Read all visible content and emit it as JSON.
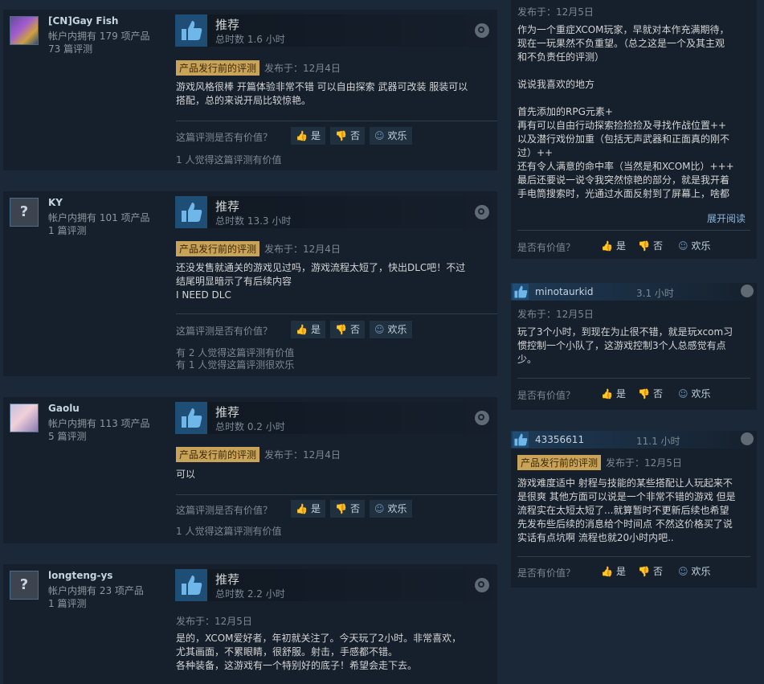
{
  "ui": {
    "recommend": "推荐",
    "was_helpful": "这篇评测是否有价值？",
    "yes": "是",
    "no": "否",
    "funny": "欢乐",
    "right_was_helpful": "是否有价值？",
    "expand": "展开阅读",
    "prerelease": "产品发行前的评测"
  },
  "reviews": [
    {
      "name": "[CN]Gay Fish",
      "products": "帐户内拥有 179 项产品",
      "count": "73 篇评测",
      "hours": "总时数 1.6 小时",
      "posted": "发布于：12月4日",
      "body": "游戏风格很棒 开篇体验非常不错 可以自由探索 武器可改装 服装可以\n搭配，总的来说开局比较惊艳。",
      "helpful1": "1 人觉得这篇评测有价值",
      "helpful2": ""
    },
    {
      "name": "KY",
      "products": "帐户内拥有 101 项产品",
      "count": "1 篇评测",
      "hours": "总时数 13.3 小时",
      "posted": "发布于：12月4日",
      "body": "还没发售就通关的游戏见过吗，游戏流程太短了，快出DLC吧！不过\n结尾明显暗示了有后续内容\nI NEED DLC",
      "helpful1": "有 2 人觉得这篇评测有价值",
      "helpful2": "有 1 人觉得这篇评测很欢乐"
    },
    {
      "name": "Gaolu",
      "products": "帐户内拥有 113 项产品",
      "count": "5 篇评测",
      "hours": "总时数 0.2 小时",
      "posted": "发布于：12月4日",
      "body": "可以",
      "helpful1": "1 人觉得这篇评测有价值",
      "helpful2": ""
    },
    {
      "name": "longteng-ys",
      "products": "帐户内拥有 23 项产品",
      "count": "1 篇评测",
      "hours": "总时数 2.2 小时",
      "posted": "发布于：12月5日",
      "body": "是的，XCOM爱好者，年初就关注了。今天玩了2小时。非常喜欢，\n尤其画面，不累眼睛，很舒服。射击，手感都不错。\n各种装备，这游戏有一个特别好的底子！希望会走下去。",
      "helpful1": "",
      "helpful2": ""
    }
  ],
  "right": [
    {
      "name": "",
      "hours": "",
      "posted": "发布于：12月5日",
      "body": "作为一个重症XCOM玩家，早就对本作充满期待，\n现在一玩果然不负重望。（总之这是一个及其主观\n和不负责任的评测）\n\n说说我喜欢的地方\n\n首先添加的RPG元素+\n再有可以自由行动探索捡捡捡及寻找作战位置++\n以及潜行戏份加重（包括无声武器和正面真的刚不\n过）++\n还有令人满意的命中率（当然是和XCOM比）+++\n最后还要说一说令我突然惊艳的部分，就是我开着\n手电筒搜索时，光通过水面反射到了屏幕上，啥都"
    },
    {
      "name": "minotaurkid",
      "hours": "3.1 小时",
      "posted": "发布于：12月5日",
      "body": "玩了3个小时，到现在为止很不错，就是玩xcom习\n惯控制一个小队了，这游戏控制3个人总感觉有点\n少。"
    },
    {
      "name": "43356611",
      "hours": "11.1 小时",
      "posted": "发布于：12月5日",
      "body": "游戏难度适中 射程与技能的某些搭配让人玩起来不\n是很爽 其他方面可以说是一个非常不错的游戏 但是\n流程实在太短太短了...就算暂时不更新后续也希望\n先发布些后续的消息给个时间点 不然这价格买了说\n实话有点坑啊 流程也就20小时内吧.."
    }
  ]
}
